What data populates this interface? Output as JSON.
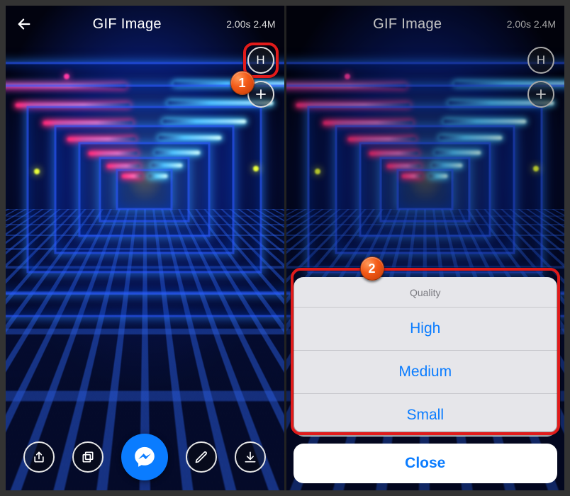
{
  "left": {
    "title": "GIF Image",
    "meta": "2.00s 2.4M",
    "fabs": {
      "quality": "H",
      "add": "+"
    },
    "bottom": [
      "share",
      "layers",
      "messenger",
      "edit",
      "download"
    ],
    "badge": "1"
  },
  "right": {
    "title": "GIF Image",
    "meta": "2.00s 2.4M",
    "fabs": {
      "quality": "H",
      "add": "+"
    },
    "sheet": {
      "header": "Quality",
      "items": [
        "High",
        "Medium",
        "Small"
      ],
      "close": "Close"
    },
    "badge": "2"
  }
}
